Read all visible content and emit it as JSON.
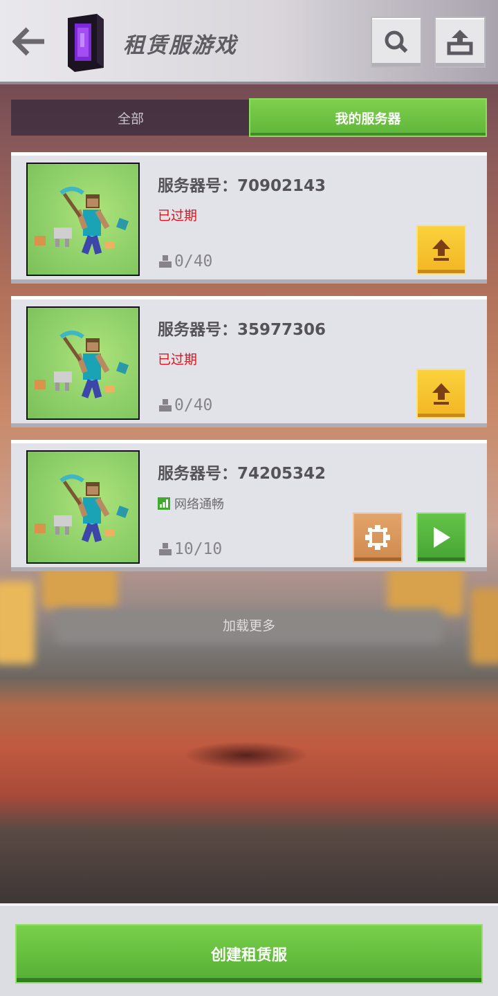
{
  "header": {
    "title": "租赁服游戏"
  },
  "tabs": {
    "all_label": "全部",
    "mine_label": "我的服务器"
  },
  "servers": [
    {
      "id_label": "服务器号：70902143",
      "status": "已过期",
      "players": "0/40"
    },
    {
      "id_label": "服务器号：35977306",
      "status": "已过期",
      "players": "0/40"
    },
    {
      "id_label": "服务器号：74205342",
      "status": "网络通畅",
      "players": "10/10"
    }
  ],
  "load_more": "加载更多",
  "footer": {
    "create_label": "创建租赁服"
  },
  "colors": {
    "accent_green": "#5fb63a",
    "expired_red": "#e0121a",
    "upgrade_yellow": "#f2b623",
    "settings_orange": "#d08a4e"
  }
}
